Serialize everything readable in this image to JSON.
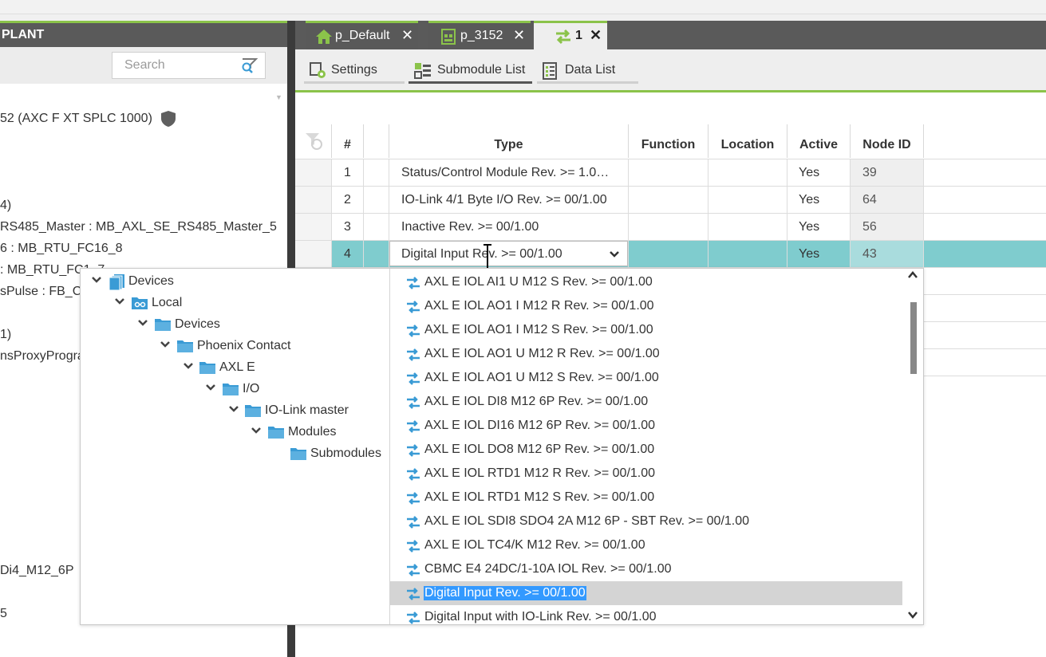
{
  "left_panel": {
    "title": "PLANT",
    "search_placeholder": "Search",
    "tree": [
      "52 (AXC F XT SPLC 1000)",
      "4)",
      "RS485_Master : MB_AXL_SE_RS485_Master_5",
      "6 : MB_RTU_FC16_8",
      ": MB_RTU_FC1_7",
      "sPulse : FB_C",
      "1)",
      "nsProxyProgra",
      "Di4_M12_6P",
      "5"
    ]
  },
  "tabs": [
    {
      "label": "p_Default",
      "icon": "home-icon"
    },
    {
      "label": "p_3152",
      "icon": "device-icon"
    },
    {
      "label": "1",
      "icon": "swap-arrows-icon",
      "active": true
    }
  ],
  "editor_tabs": [
    {
      "label": "Settings",
      "icon": "settings-icon"
    },
    {
      "label": "Submodule List",
      "icon": "submodule-list-icon",
      "active": true
    },
    {
      "label": "Data List",
      "icon": "data-list-icon"
    }
  ],
  "grid": {
    "headers": [
      "#",
      "Type",
      "Function",
      "Location",
      "Active",
      "Node ID"
    ],
    "rows": [
      {
        "num": "1",
        "type": "Status/Control Module Rev. >= 1.0…",
        "function": "",
        "location": "",
        "active": "Yes",
        "node_id": "39"
      },
      {
        "num": "2",
        "type": "IO-Link 4/1 Byte I/O Rev. >= 00/1.00",
        "function": "",
        "location": "",
        "active": "Yes",
        "node_id": "64"
      },
      {
        "num": "3",
        "type": "Inactive Rev. >= 00/1.00",
        "function": "",
        "location": "",
        "active": "Yes",
        "node_id": "56"
      },
      {
        "num": "4",
        "type": "Digital Input Rev. >= 00/1.00",
        "function": "",
        "location": "",
        "active": "Yes",
        "node_id": "43"
      }
    ]
  },
  "popup": {
    "tree": [
      "Devices",
      "Local",
      "Devices",
      "Phoenix Contact",
      "AXL E",
      "I/O",
      "IO-Link master",
      "Modules",
      "Submodules"
    ],
    "items": [
      "AXL E IOL AI1 U M12 S Rev. >= 00/1.00",
      "AXL E IOL AO1 I M12 R Rev. >= 00/1.00",
      "AXL E IOL AO1 I M12 S Rev. >= 00/1.00",
      "AXL E IOL AO1 U M12 R Rev. >= 00/1.00",
      "AXL E IOL AO1 U M12 S Rev. >= 00/1.00",
      "AXL E IOL DI8 M12 6P Rev. >= 00/1.00",
      "AXL E IOL DI16 M12 6P Rev. >= 00/1.00",
      "AXL E IOL DO8 M12 6P Rev. >= 00/1.00",
      "AXL E IOL RTD1 M12 R Rev. >= 00/1.00",
      "AXL E IOL RTD1 M12 S Rev. >= 00/1.00",
      "AXL E IOL SDI8 SDO4 2A M12 6P - SBT Rev. >= 00/1.00",
      "AXL E IOL TC4/K M12 Rev. >= 00/1.00",
      "CBMC E4 24DC/1-10A IOL Rev. >= 00/1.00",
      "Digital Input Rev. >= 00/1.00",
      "Digital Input with IO-Link Rev. >= 00/1.00"
    ],
    "selected_index": 13
  },
  "colors": {
    "accent_green": "#8bc34a",
    "selected_row": "#7fccce",
    "dark_header": "#5a5a5a",
    "folder_blue": "#3a9bd5"
  }
}
